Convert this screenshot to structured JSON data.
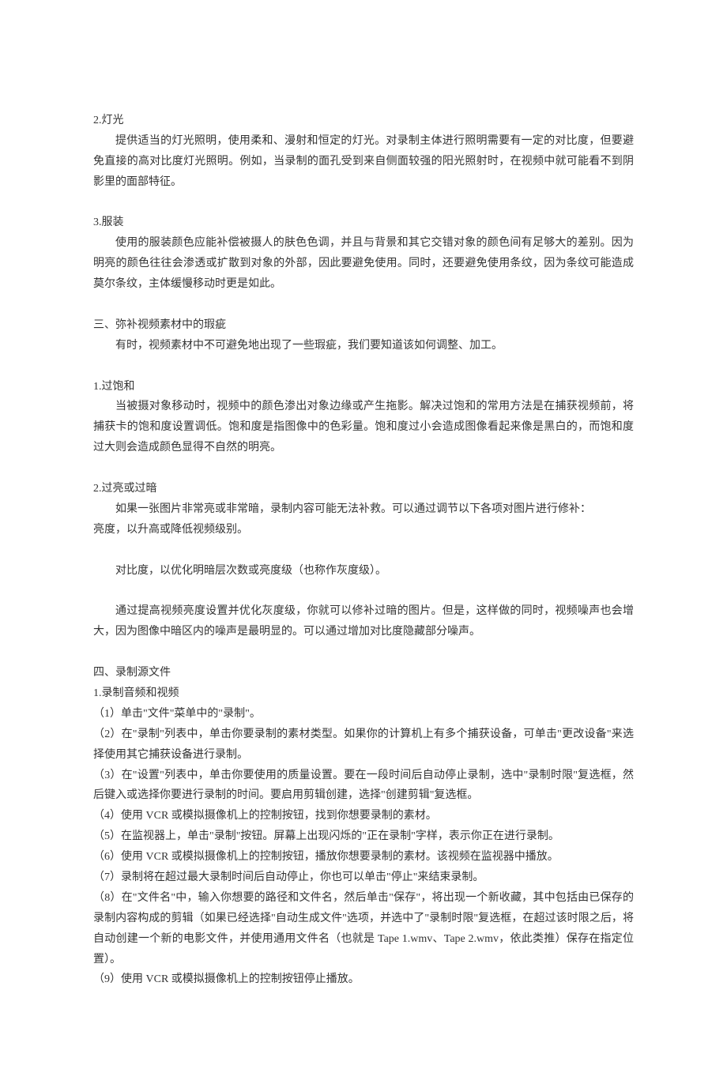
{
  "s2": {
    "title": "2.灯光",
    "p1": "提供适当的灯光照明，使用柔和、漫射和恒定的灯光。对录制主体进行照明需要有一定的对比度，但要避免直接的高对比度灯光照明。例如，当录制的面孔受到来自侧面较强的阳光照射时，在视频中就可能看不到阴影里的面部特征。"
  },
  "s3": {
    "title": "3.服装",
    "p1": "使用的服装颜色应能补偿被摄人的肤色色调，并且与背景和其它交错对象的颜色间有足够大的差别。因为明亮的颜色往往会渗透或扩散到对象的外部，因此要避免使用。同时，还要避免使用条纹，因为条纹可能造成莫尔条纹，主体缓慢移动时更是如此。"
  },
  "h3": {
    "title": "三、弥补视频素材中的瑕疵",
    "p1": "有时，视频素材中不可避免地出现了一些瑕疵，我们要知道该如何调整、加工。"
  },
  "s31": {
    "title": "1.过饱和",
    "p1": "当被摄对象移动时，视频中的颜色渗出对象边缘或产生拖影。解决过饱和的常用方法是在捕获视频前，将捕获卡的饱和度设置调低。饱和度是指图像中的色彩量。饱和度过小会造成图像看起来像是黑白的，而饱和度过大则会造成颜色显得不自然的明亮。"
  },
  "s32": {
    "title": "2.过亮或过暗",
    "p1": "如果一张图片非常亮或非常暗，录制内容可能无法补救。可以通过调节以下各项对图片进行修补：",
    "p2": "亮度，以升高或降低视频级别。",
    "p3": "对比度，以优化明暗层次数或亮度级（也称作灰度级）。",
    "p4": "通过提高视频亮度设置并优化灰度级，你就可以修补过暗的图片。但是，这样做的同时，视频噪声也会增大，因为图像中暗区内的噪声是最明显的。可以通过增加对比度隐藏部分噪声。"
  },
  "h4": {
    "title": "四、录制源文件"
  },
  "s41": {
    "title": "1.录制音频和视频",
    "i1": "（1）单击\"文件\"菜单中的\"录制\"。",
    "i2": "（2）在\"录制\"列表中，单击你要录制的素材类型。如果你的计算机上有多个捕获设备，可单击\"更改设备\"来选择使用其它捕获设备进行录制。",
    "i3": "（3）在\"设置\"列表中，单击你要使用的质量设置。要在一段时间后自动停止录制，选中\"录制时限\"复选框，然后键入或选择你要进行录制的时间。要启用剪辑创建，选择\"创建剪辑\"复选框。",
    "i4": "（4）使用 VCR 或模拟摄像机上的控制按钮，找到你想要录制的素材。",
    "i5": "（5）在监视器上，单击\"录制\"按钮。屏幕上出现闪烁的\"正在录制\"字样，表示你正在进行录制。",
    "i6": "（6）使用 VCR 或模拟摄像机上的控制按钮，播放你想要录制的素材。该视频在监视器中播放。",
    "i7": "（7）录制将在超过最大录制时间后自动停止，你也可以单击\"停止\"来结束录制。",
    "i8": "（8）在\"文件名\"中，输入你想要的路径和文件名，然后单击\"保存\"，将出现一个新收藏，其中包括由已保存的录制内容构成的剪辑（如果已经选择\"自动生成文件\"选项，并选中了\"录制时限\"复选框，在超过该时限之后，将自动创建一个新的电影文件，并使用通用文件名（也就是 Tape 1.wmv、Tape 2.wmv，依此类推）保存在指定位置）。",
    "i9": "（9）使用 VCR 或模拟摄像机上的控制按钮停止播放。"
  }
}
